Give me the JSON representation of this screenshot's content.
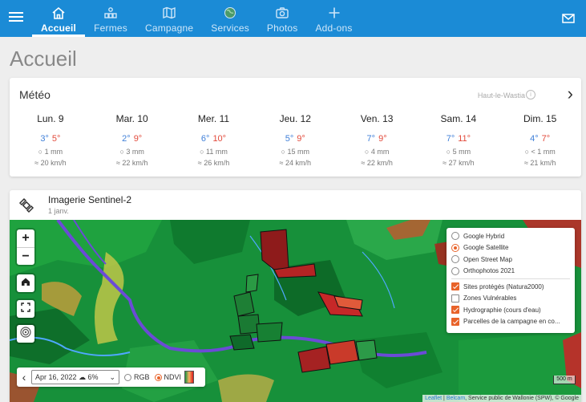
{
  "nav": {
    "items": [
      {
        "label": "Accueil",
        "icon": "home-icon",
        "active": true
      },
      {
        "label": "Fermes",
        "icon": "farm-icon",
        "active": false
      },
      {
        "label": "Campagne",
        "icon": "map-icon",
        "active": false
      },
      {
        "label": "Services",
        "icon": "globe-icon",
        "active": false
      },
      {
        "label": "Photos",
        "icon": "camera-icon",
        "active": false
      },
      {
        "label": "Add-ons",
        "icon": "plus-icon",
        "active": false
      }
    ]
  },
  "page": {
    "title": "Accueil"
  },
  "meteo": {
    "title": "Météo",
    "location": "Haut-le-Wastia",
    "days": [
      {
        "name": "Lun. 9",
        "min": "3°",
        "max": "5°",
        "rain": "1 mm",
        "wind": "20 km/h"
      },
      {
        "name": "Mar. 10",
        "min": "2°",
        "max": "9°",
        "rain": "3 mm",
        "wind": "22 km/h"
      },
      {
        "name": "Mer. 11",
        "min": "6°",
        "max": "10°",
        "rain": "11 mm",
        "wind": "26 km/h"
      },
      {
        "name": "Jeu. 12",
        "min": "5°",
        "max": "9°",
        "rain": "15 mm",
        "wind": "24 km/h"
      },
      {
        "name": "Ven. 13",
        "min": "7°",
        "max": "9°",
        "rain": "4 mm",
        "wind": "22 km/h"
      },
      {
        "name": "Sam. 14",
        "min": "7°",
        "max": "11°",
        "rain": "5 mm",
        "wind": "27 km/h"
      },
      {
        "name": "Dim. 15",
        "min": "4°",
        "max": "7°",
        "rain": "< 1 mm",
        "wind": "21 km/h"
      }
    ]
  },
  "sentinel": {
    "title": "Imagerie Sentinel-2",
    "date": "1 janv.",
    "zoom_in": "+",
    "zoom_out": "−",
    "base_layers": [
      {
        "label": "Google Hybrid",
        "selected": false
      },
      {
        "label": "Google Satellite",
        "selected": true
      },
      {
        "label": "Open Street Map",
        "selected": false
      },
      {
        "label": "Orthophotos 2021",
        "selected": false
      }
    ],
    "overlays": [
      {
        "label": "Sites protégés (Natura2000)",
        "checked": true
      },
      {
        "label": "Zones Vulnérables",
        "checked": false
      },
      {
        "label": "Hydrographie (cours d'eau)",
        "checked": true
      },
      {
        "label": "Parcelles de la campagne en co...",
        "checked": true
      }
    ],
    "image_date": "Apr 16, 2022 ☁ 6%",
    "mode_rgb": "RGB",
    "mode_ndvi": "NDVI",
    "mode_selected": "NDVI",
    "scale": "500 m",
    "attribution": {
      "leaflet": "Leaflet",
      "sep1": " | ",
      "belcam": "Belcam",
      "rest": ", Service public de Wallonie (SPW), © Google"
    }
  },
  "colors": {
    "nav_bg": "#1b8bd6",
    "accent": "#e8632a",
    "temp_min": "#3f7fd8",
    "temp_max": "#e24a3b"
  }
}
